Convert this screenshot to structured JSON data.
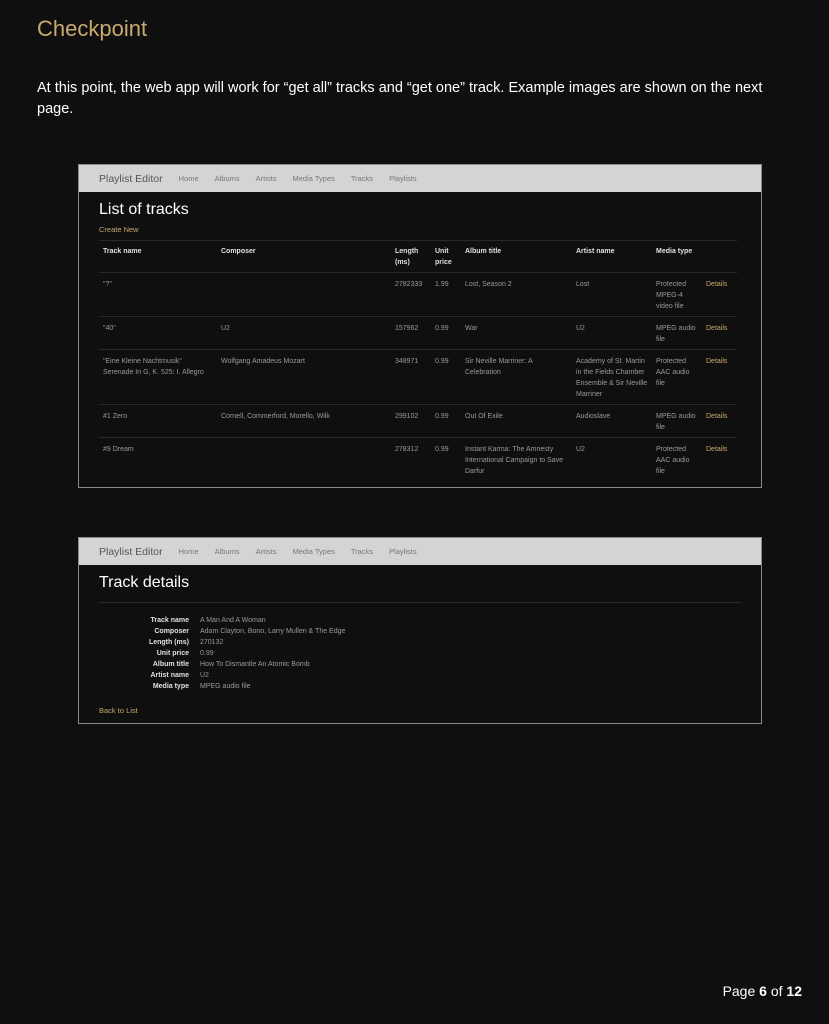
{
  "document": {
    "heading": "Checkpoint",
    "paragraph": "At this point, the web app will work for “get all” tracks and “get one” track.  Example images are shown on the next page."
  },
  "app": {
    "brand": "Playlist Editor",
    "nav": [
      "Home",
      "Albums",
      "Artists",
      "Media Types",
      "Tracks",
      "Playlists"
    ]
  },
  "list_page": {
    "title": "List of tracks",
    "create_link": "Create New",
    "headers": [
      "Track name",
      "Composer",
      "Length (ms)",
      "Unit price",
      "Album title",
      "Artist name",
      "Media type",
      ""
    ],
    "details_label": "Details",
    "rows": [
      {
        "track": "\"?\"",
        "composer": "",
        "length": "2782333",
        "price": "1.99",
        "album": "Lost, Season 2",
        "artist": "Lost",
        "media": "Protected MPEG-4 video file"
      },
      {
        "track": "\"40\"",
        "composer": "U2",
        "length": "157962",
        "price": "0.99",
        "album": "War",
        "artist": "U2",
        "media": "MPEG audio file"
      },
      {
        "track": "\"Eine Kleine Nachtmusik\" Serenade In G, K. 525: I. Allegro",
        "composer": "Wolfgang Amadeus Mozart",
        "length": "348971",
        "price": "0.99",
        "album": "Sir Neville Marriner: A Celebration",
        "artist": "Academy of St. Martin in the Fields Chamber Ensemble & Sir Neville Marriner",
        "media": "Protected AAC audio file"
      },
      {
        "track": "#1 Zero",
        "composer": "Cornell, Commerford, Morello, Wilk",
        "length": "299102",
        "price": "0.99",
        "album": "Out Of Exile",
        "artist": "Audioslave",
        "media": "MPEG audio file"
      },
      {
        "track": "#9 Dream",
        "composer": "",
        "length": "278312",
        "price": "0.99",
        "album": "Instant Karma: The Amnesty International Campaign to Save Darfur",
        "artist": "U2",
        "media": "Protected AAC audio file"
      }
    ]
  },
  "details_page": {
    "title": "Track details",
    "fields": [
      {
        "label": "Track name",
        "value": "A Man And A Woman"
      },
      {
        "label": "Composer",
        "value": "Adam Clayton, Bono, Larry Mullen & The Edge"
      },
      {
        "label": "Length (ms)",
        "value": "270132"
      },
      {
        "label": "Unit price",
        "value": "0.99"
      },
      {
        "label": "Album title",
        "value": "How To Dismantle An Atomic Bomb"
      },
      {
        "label": "Artist name",
        "value": "U2"
      },
      {
        "label": "Media type",
        "value": "MPEG audio file"
      }
    ],
    "back_link": "Back to List"
  },
  "footer": {
    "prefix": "Page ",
    "current": "6",
    "middle": " of ",
    "total": "12"
  }
}
